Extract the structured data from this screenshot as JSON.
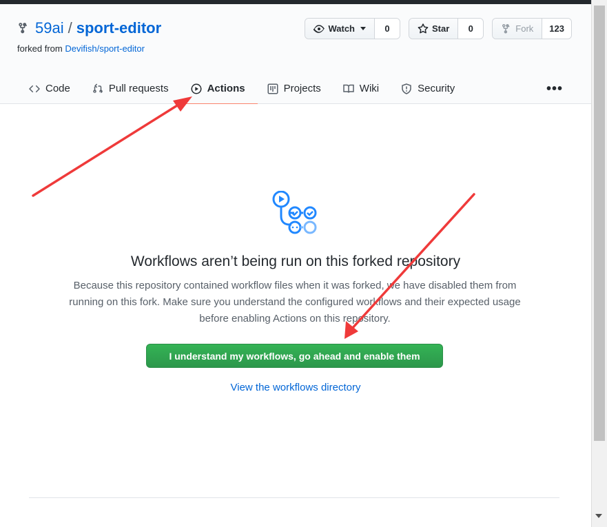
{
  "repo": {
    "owner": "59ai",
    "separator": "/",
    "name": "sport-editor",
    "forked_prefix": "forked from",
    "forked_source": "Devifish/sport-editor"
  },
  "buttons": {
    "watch_label": "Watch",
    "watch_count": "0",
    "star_label": "Star",
    "star_count": "0",
    "fork_label": "Fork",
    "fork_count": "123"
  },
  "tabs": [
    {
      "label": "Code",
      "icon": "code-icon"
    },
    {
      "label": "Pull requests",
      "icon": "pull-request-icon"
    },
    {
      "label": "Actions",
      "icon": "play-icon",
      "active": true
    },
    {
      "label": "Projects",
      "icon": "project-icon"
    },
    {
      "label": "Wiki",
      "icon": "book-icon"
    },
    {
      "label": "Security",
      "icon": "shield-icon"
    }
  ],
  "more_label": "•••",
  "main": {
    "heading": "Workflows aren’t being run on this forked repository",
    "description": "Because this repository contained workflow files when it was forked, we have disabled them from running on this fork. Make sure you understand the configured workflows and their expected usage before enabling Actions on this repository.",
    "enable_button": "I understand my workflows, go ahead and enable them",
    "view_link": "View the workflows directory"
  },
  "colors": {
    "link": "#0366d6",
    "primary_button": "#2ea44f",
    "active_tab_underline": "#f9826c",
    "annotation_arrow": "#ef3a3a"
  }
}
